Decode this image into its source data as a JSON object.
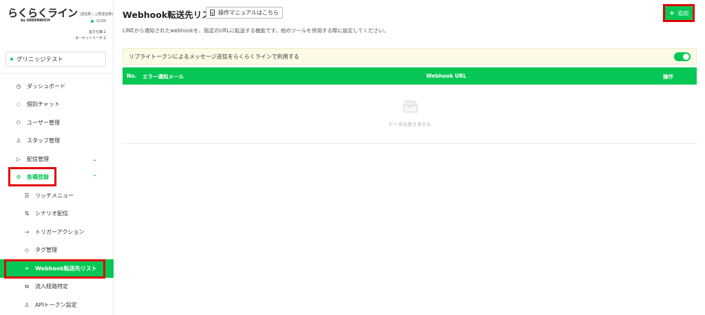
{
  "app": {
    "logo_text": "らくらくライン",
    "logo_sub": "(送信数 / 上限送信数)",
    "logo_by": "by GREENWICH",
    "send_count": "3/200",
    "friends": "友だち数:2",
    "target_reach": "ターゲットリーチ:2",
    "brand_color": "#06c755"
  },
  "account": {
    "name": "グリニッジテスト"
  },
  "sidebar": {
    "items": [
      {
        "label": "ダッシュボード",
        "icon": "dashboard-icon"
      },
      {
        "label": "個別チャット",
        "icon": "chat-icon"
      },
      {
        "label": "ユーザー管理",
        "icon": "users-icon"
      },
      {
        "label": "スタッフ管理",
        "icon": "staff-icon"
      },
      {
        "label": "配信管理",
        "icon": "send-icon"
      },
      {
        "label": "各種登録",
        "icon": "gear-icon"
      }
    ],
    "subitems": [
      {
        "label": "リッチメニュー",
        "icon": "menu-icon"
      },
      {
        "label": "シナリオ配信",
        "icon": "scenario-icon"
      },
      {
        "label": "トリガーアクション",
        "icon": "trigger-icon"
      },
      {
        "label": "タグ管理",
        "icon": "tag-icon"
      },
      {
        "label": "Webhook転送先リスト",
        "icon": "link-icon"
      },
      {
        "label": "流入経路特定",
        "icon": "route-icon"
      },
      {
        "label": "APIトークン設定",
        "icon": "key-icon"
      }
    ]
  },
  "main": {
    "title": "Webhook転送先リスト",
    "manual_label": "操作マニュアルはこちら",
    "description": "LINEから通知されたwebhookを、指定のURLに転送する機能です。他のツールを併用する際に設定してください。",
    "add_label": "追加",
    "notice": "リプライトークンによるメッセージ送信をらくらくラインで利用する",
    "toggle_on": true,
    "table": {
      "headers": [
        "No.",
        "エラー通知メール",
        "Webhook URL",
        "操作"
      ],
      "empty_text": "データはありません"
    }
  }
}
